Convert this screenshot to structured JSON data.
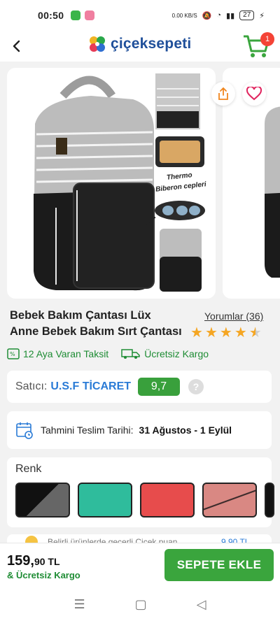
{
  "status": {
    "time": "00:50",
    "battery": "27",
    "net": "0.00 KB/S"
  },
  "header": {
    "brand": "çiçeksepeti",
    "cart_count": "1"
  },
  "product": {
    "title_line1": "Bebek Bakım Çantası Lüx",
    "title_line2": "Anne Bebek Bakım Sırt Çantası",
    "reviews_label": "Yorumlar (36)",
    "rating": 4.5,
    "image_labels": {
      "thermo": "Thermo",
      "biberon": "Biberon cepleri"
    }
  },
  "perks": {
    "installment": "12 Aya Varan Taksit",
    "shipping": "Ücretsiz Kargo"
  },
  "seller": {
    "label": "Satıcı:",
    "name": "U.S.F TİCARET",
    "score": "9,7",
    "help": "?"
  },
  "delivery": {
    "label": "Tahmini Teslim Tarihi:",
    "value": "31 Ağustos - 1 Eylül"
  },
  "colors": {
    "title": "Renk",
    "options": [
      {
        "name": "black-grey",
        "c1": "#111111",
        "c2": "#666666"
      },
      {
        "name": "mint",
        "c1": "#2fbc9c",
        "c2": "#2fbc9c"
      },
      {
        "name": "red",
        "c1": "#e74c4c",
        "c2": "#e74c4c"
      },
      {
        "name": "pink",
        "c1": "#d98883",
        "c2": "#d98883"
      }
    ]
  },
  "promo": {
    "text": "Belirli ürünlerde geçerli Çiçek puan",
    "amount": "9,90 TL"
  },
  "bottom": {
    "price_main": "159,",
    "price_cents": "90 TL",
    "shipping": "& Ücretsiz Kargo",
    "cta": "SEPETE EKLE"
  },
  "theme": {
    "brand_blue": "#1f4f9a",
    "green": "#3aa53d",
    "link_blue": "#2a7bd6",
    "star": "#f5a623"
  }
}
